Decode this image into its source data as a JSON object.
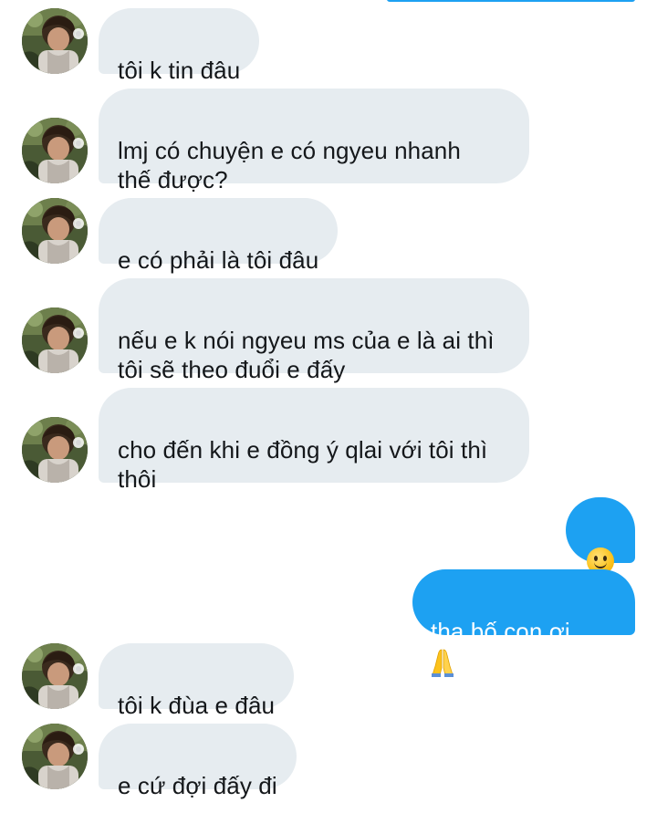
{
  "messages": [
    {
      "side": "in",
      "text": "tôi k tin đâu"
    },
    {
      "side": "in",
      "text": "lmj có chuyện e có ngyeu nhanh\nthế được?"
    },
    {
      "side": "in",
      "text": "e có phải là tôi đâu"
    },
    {
      "side": "in",
      "text": "nếu e k nói ngyeu ms của e là ai thì\ntôi sẽ theo đuổi e đấy"
    },
    {
      "side": "in",
      "text": "cho đến khi e đồng ý qlai với tôi thì\nthôi"
    },
    {
      "side": "out",
      "emoji": "slightly-smiling-face"
    },
    {
      "side": "out",
      "text": "tha bố con ơi",
      "emoji": "folded-hands"
    },
    {
      "side": "in",
      "text": "tôi k đùa e đâu"
    },
    {
      "side": "in",
      "text": "e cứ đợi đấy đi"
    }
  ],
  "colors": {
    "incoming_bubble": "#e6ecf0",
    "incoming_text": "#14171a",
    "outgoing_bubble": "#1da1f2",
    "outgoing_text": "#ffffff"
  }
}
